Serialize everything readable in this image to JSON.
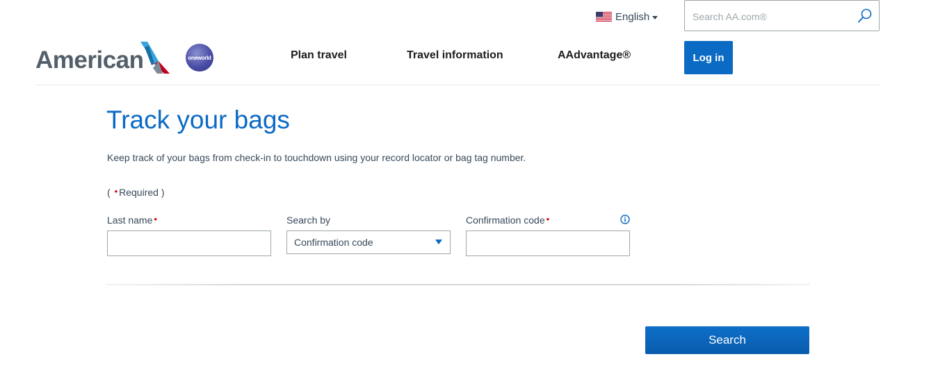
{
  "header": {
    "language": {
      "label": "English",
      "flag": "us-flag-icon"
    },
    "search": {
      "placeholder": "Search AA.com®",
      "value": ""
    },
    "logo": {
      "text": "American",
      "partner_badge": "oneworld"
    },
    "nav": [
      {
        "label": "Plan travel"
      },
      {
        "label": "Travel information"
      },
      {
        "label": "AAdvantage®"
      }
    ],
    "login_label": "Log in"
  },
  "main": {
    "title": "Track your bags",
    "intro": "Keep track of your bags from check-in to touchdown using your record locator or bag tag number.",
    "required": {
      "open": "( ",
      "label": "Required",
      "close": " )"
    },
    "fields": {
      "last_name": {
        "label": "Last name",
        "required": true,
        "value": ""
      },
      "search_by": {
        "label": "Search by",
        "selected": "Confirmation code"
      },
      "confirmation_code": {
        "label": "Confirmation code",
        "required": true,
        "value": ""
      }
    },
    "search_button": "Search"
  },
  "colors": {
    "brand_blue": "#0b6ac4",
    "required_red": "#d40000",
    "text": "#36495a",
    "nav_text": "#1d1d1d"
  }
}
